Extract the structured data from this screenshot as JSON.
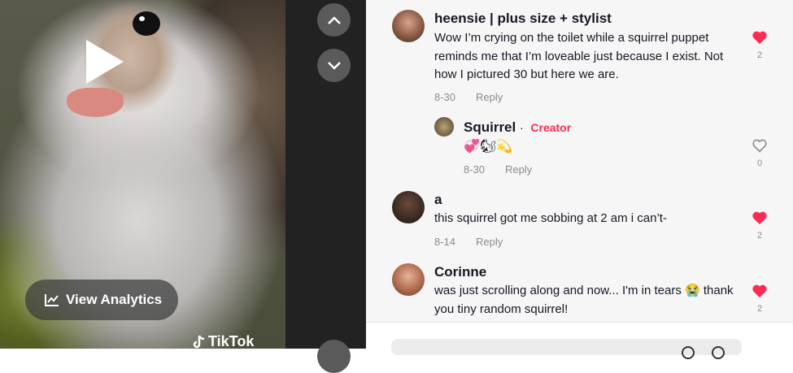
{
  "video": {
    "analytics_label": "View Analytics",
    "watermark": "TikTok"
  },
  "comments": [
    {
      "author": "heensie | plus size + stylist",
      "text": "Wow I’m crying on the toilet while a squirrel puppet reminds me that I’m loveable just because I exist. Not how I pictured 30 but here we are.",
      "date": "8-30",
      "reply_label": "Reply",
      "likes": "2",
      "liked": true
    },
    {
      "author": "Squirrel",
      "separator": "·",
      "badge": "Creator",
      "text": "💞🐿💫",
      "date": "8-30",
      "reply_label": "Reply",
      "likes": "0",
      "liked": false
    },
    {
      "author": "a",
      "text": "this squirrel got me sobbing at 2 am i can’t-",
      "date": "8-14",
      "reply_label": "Reply",
      "likes": "2",
      "liked": true
    },
    {
      "author": "Corinne",
      "text": "was just scrolling along and now... I'm in tears 😭 thank you tiny random squirrel!",
      "likes": "2",
      "liked": true
    }
  ],
  "icons": {
    "nav_up": "chevron-up-icon",
    "nav_down": "chevron-down-icon",
    "analytics": "chart-line-icon",
    "heart_filled": "heart-filled-icon",
    "heart_outline": "heart-outline-icon"
  },
  "colors": {
    "heart": "#fe2c55",
    "creator_badge": "#fe2c55",
    "secondary_text": "#8a8b91"
  }
}
